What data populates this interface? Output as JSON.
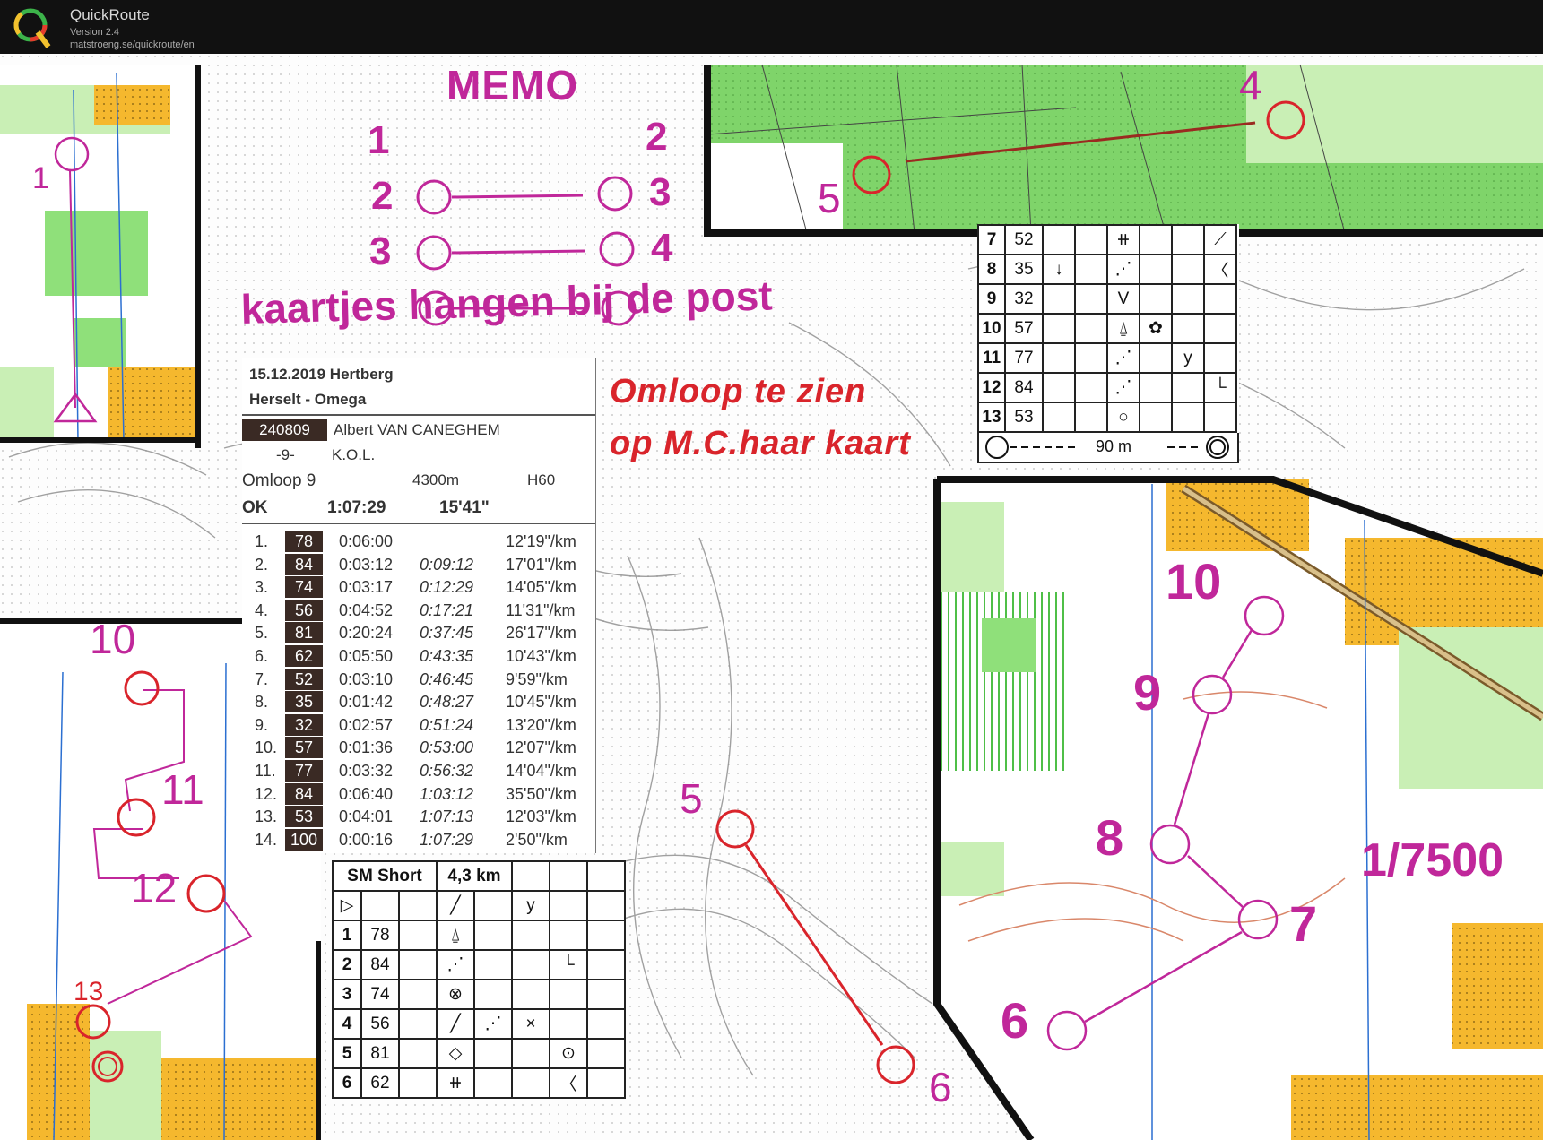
{
  "app": {
    "name": "QuickRoute",
    "version": "Version 2.4",
    "url": "matstroeng.se/quickroute/en"
  },
  "memo": {
    "title": "MEMO",
    "legs": [
      {
        "from": "1",
        "to": "2"
      },
      {
        "from": "2",
        "to": "3"
      },
      {
        "from": "3",
        "to": "4"
      }
    ],
    "note": "kaartjes hangen bij de post"
  },
  "annotation": {
    "line1": "Omloop te zien",
    "line2": "op M.C.haar kaart"
  },
  "splits": {
    "date_place": "15.12.2019  Hertberg",
    "event": "Herselt - Omega",
    "bib": "240809",
    "name": "Albert VAN CANEGHEM",
    "number": "-9-",
    "club": "K.O.L.",
    "course": "Omloop 9",
    "length": "4300m",
    "category": "H60",
    "status": "OK",
    "total_time": "1:07:29",
    "pace": "15'41\"",
    "rows": [
      {
        "n": "1.",
        "code": "78",
        "leg": "0:06:00",
        "cum": "",
        "pace": "12'19\"/km"
      },
      {
        "n": "2.",
        "code": "84",
        "leg": "0:03:12",
        "cum": "0:09:12",
        "pace": "17'01\"/km"
      },
      {
        "n": "3.",
        "code": "74",
        "leg": "0:03:17",
        "cum": "0:12:29",
        "pace": "14'05\"/km"
      },
      {
        "n": "4.",
        "code": "56",
        "leg": "0:04:52",
        "cum": "0:17:21",
        "pace": "11'31\"/km"
      },
      {
        "n": "5.",
        "code": "81",
        "leg": "0:20:24",
        "cum": "0:37:45",
        "pace": "26'17\"/km"
      },
      {
        "n": "6.",
        "code": "62",
        "leg": "0:05:50",
        "cum": "0:43:35",
        "pace": "10'43\"/km"
      },
      {
        "n": "7.",
        "code": "52",
        "leg": "0:03:10",
        "cum": "0:46:45",
        "pace": "9'59\"/km"
      },
      {
        "n": "8.",
        "code": "35",
        "leg": "0:01:42",
        "cum": "0:48:27",
        "pace": "10'45\"/km"
      },
      {
        "n": "9.",
        "code": "32",
        "leg": "0:02:57",
        "cum": "0:51:24",
        "pace": "13'20\"/km"
      },
      {
        "n": "10.",
        "code": "57",
        "leg": "0:01:36",
        "cum": "0:53:00",
        "pace": "12'07\"/km"
      },
      {
        "n": "11.",
        "code": "77",
        "leg": "0:03:32",
        "cum": "0:56:32",
        "pace": "14'04\"/km"
      },
      {
        "n": "12.",
        "code": "84",
        "leg": "0:06:40",
        "cum": "1:03:12",
        "pace": "35'50\"/km"
      },
      {
        "n": "13.",
        "code": "53",
        "leg": "0:04:01",
        "cum": "1:07:13",
        "pace": "12'03\"/km"
      },
      {
        "n": "14.",
        "code": "100",
        "leg": "0:00:16",
        "cum": "1:07:29",
        "pace": "2'50\"/km"
      }
    ]
  },
  "desc_left": {
    "title": "SM Short",
    "length": "4,3 km",
    "rows": [
      {
        "n": "1",
        "code": "78"
      },
      {
        "n": "2",
        "code": "84"
      },
      {
        "n": "3",
        "code": "74"
      },
      {
        "n": "4",
        "code": "56"
      },
      {
        "n": "5",
        "code": "81"
      },
      {
        "n": "6",
        "code": "62"
      }
    ]
  },
  "desc_right": {
    "rows": [
      {
        "n": "7",
        "code": "52"
      },
      {
        "n": "8",
        "code": "35"
      },
      {
        "n": "9",
        "code": "32"
      },
      {
        "n": "10",
        "code": "57"
      },
      {
        "n": "11",
        "code": "77"
      },
      {
        "n": "12",
        "code": "84"
      },
      {
        "n": "13",
        "code": "53"
      }
    ],
    "finish_distance": "90 m"
  },
  "map_labels": {
    "c1": "1",
    "c4": "4",
    "c5_top": "5",
    "c10_left": "10",
    "c11": "11",
    "c12": "12",
    "c13": "13",
    "c5_mid": "5",
    "c6_mid": "6",
    "c10_right": "10",
    "c9": "9",
    "c8": "8",
    "c7": "7",
    "c6_right": "6",
    "scale": "1/7500"
  },
  "colors": {
    "course": "#c0279a",
    "route": "#d9242b",
    "forest_green": "#7fd46a",
    "light_green": "#c9efb5",
    "yellow": "#f5b82e",
    "title_bar": "#111111"
  }
}
